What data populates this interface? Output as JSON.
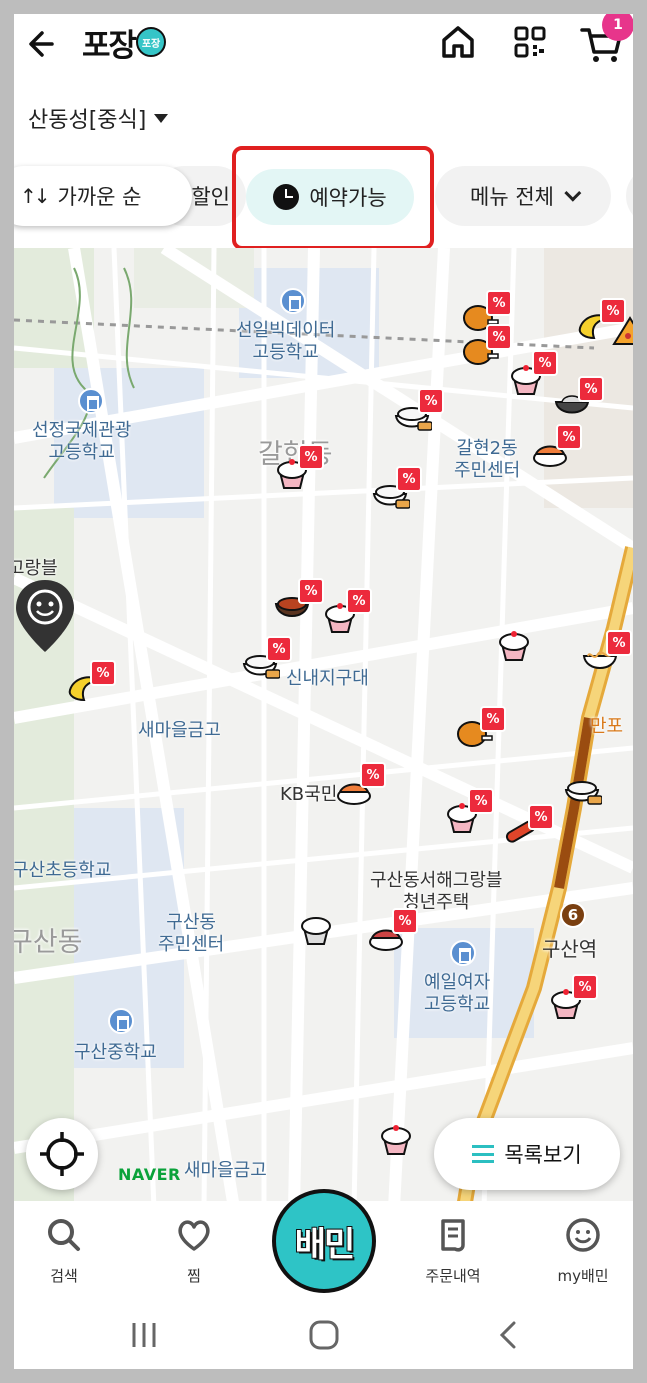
{
  "header": {
    "logo_text": "포장",
    "logo_badge": "포장",
    "cart_count": "1",
    "icons": [
      "arrow-left-icon",
      "home-icon",
      "qr-code-icon",
      "cart-icon"
    ]
  },
  "location": {
    "label": "산동성[중식]"
  },
  "filters": {
    "sort_label": "가까운 순",
    "discount_label": "할인",
    "reserve_label": "예약가능",
    "menu_label": "메뉴 전체"
  },
  "map": {
    "labels": {
      "school1": "선일빅데이터\n고등학교",
      "school2": "선정국제관광\n고등학교",
      "district1": "갈현동",
      "center1": "갈현2동\n주민센터",
      "partial1": "고랑블",
      "univ": "신내지구대",
      "bank1": "새마을금고",
      "bank2": "KB국민",
      "elem": "구산초등학교",
      "center2": "구산동\n주민센터",
      "district2": "구산동",
      "apt": "구산동서해그랑블\n청년주택",
      "station": "구산역",
      "station_no": "6",
      "girls": "예일여자\n고등학교",
      "middle": "구산중학교",
      "bank3": "새마을금고",
      "food": "만포"
    },
    "badge_text": "%",
    "naver": "NAVER"
  },
  "list_button": {
    "label": "목록보기"
  },
  "bottom_nav": {
    "items": [
      {
        "label": "검색",
        "icon": "search-icon"
      },
      {
        "label": "찜",
        "icon": "heart-icon"
      },
      {
        "label": "배민",
        "icon": "baemin-logo"
      },
      {
        "label": "주문내역",
        "icon": "receipt-icon"
      },
      {
        "label": "my배민",
        "icon": "smile-icon"
      }
    ]
  }
}
